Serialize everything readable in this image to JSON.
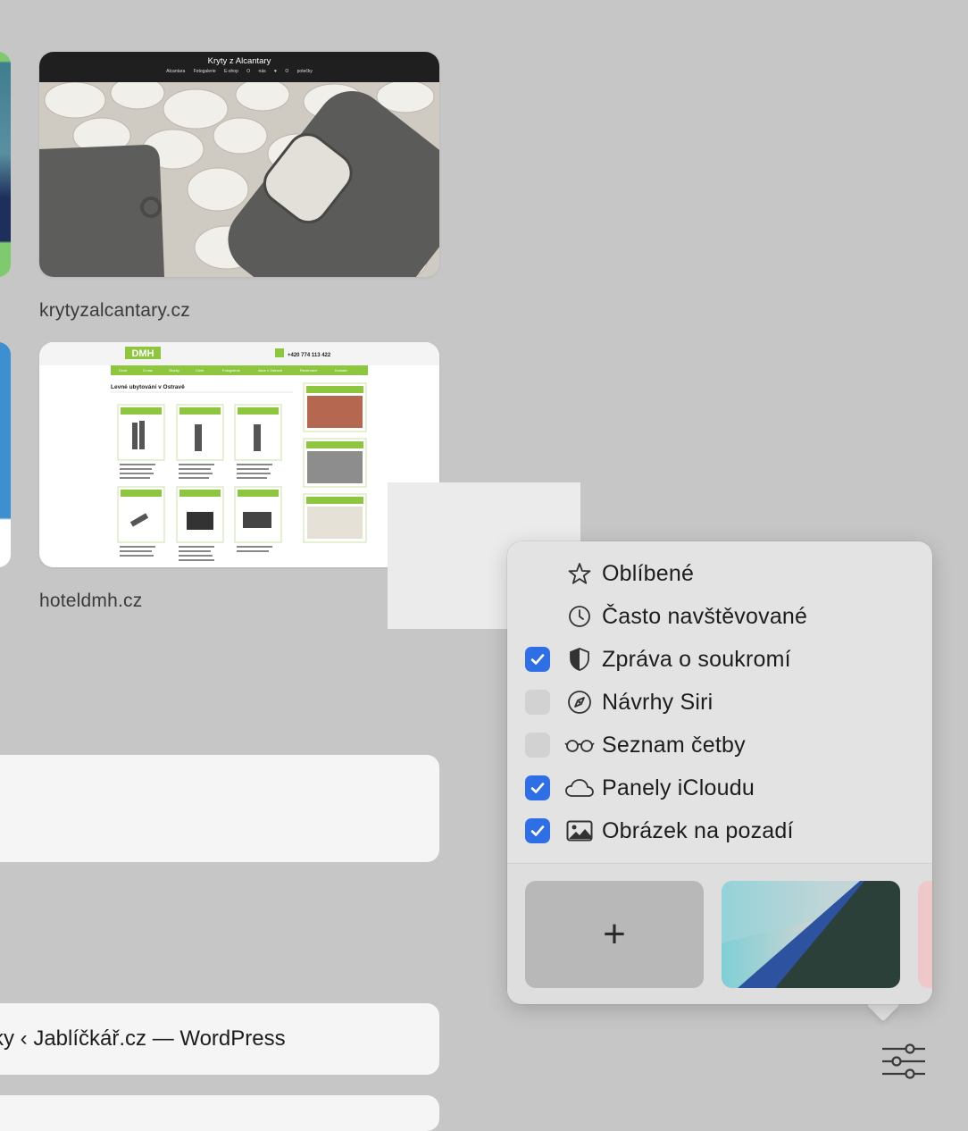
{
  "thumbnails": [
    {
      "site_title": "Kryty z Alcantary",
      "nav": [
        "Alcantara",
        "Fotogalerie",
        "E-shop",
        "O nás",
        "♥ O potečky"
      ],
      "caption": "krytyzalcantary.cz"
    },
    {
      "brand": "DMH",
      "phone": "+420 774 113 422",
      "nav": [
        "Úvod",
        "O nás",
        "Služby",
        "Cíník",
        "Fotogalerie",
        "Akce v Ostravě",
        "Rezervace",
        "Kontakt"
      ],
      "heading": "Levné ubytování v Ostravě",
      "caption": "hoteldmh.cz"
    }
  ],
  "list": {
    "row2_text": "vky ‹ Jablíčkář.cz — WordPress"
  },
  "popover": {
    "options": [
      {
        "label": "Oblíbené",
        "icon": "star-icon",
        "checked": null
      },
      {
        "label": "Často navštěvované",
        "icon": "clock-icon",
        "checked": null
      },
      {
        "label": "Zpráva o soukromí",
        "icon": "shield-icon",
        "checked": true
      },
      {
        "label": "Návrhy Siri",
        "icon": "compass-icon",
        "checked": false
      },
      {
        "label": "Seznam četby",
        "icon": "glasses-icon",
        "checked": false
      },
      {
        "label": "Panely iCloudu",
        "icon": "cloud-icon",
        "checked": true
      },
      {
        "label": "Obrázek na pozadí",
        "icon": "photo-icon",
        "checked": true
      }
    ],
    "add_tile_symbol": "+",
    "colors": {
      "checkbox_on": "#2f6fe6",
      "checkbox_off": "#d2d2d2"
    }
  },
  "settings_icon": "sliders-icon"
}
